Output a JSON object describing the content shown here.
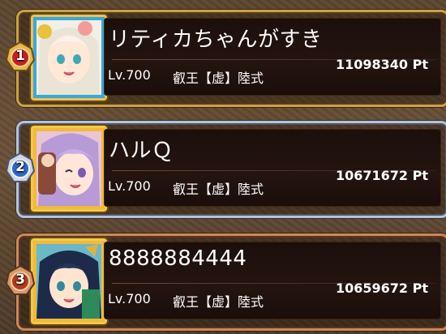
{
  "ranking": [
    {
      "rank": "1",
      "name": "リティカちゃんがすき",
      "level": "Lv.700",
      "title": "叡王【虚】陸式",
      "points": "11098340 Pt",
      "badge_color": "#c8202a",
      "avatar_icon": "elf-girl-avatar"
    },
    {
      "rank": "2",
      "name": "ハルＱ",
      "level": "Lv.700",
      "title": "叡王【虚】陸式",
      "points": "10671672 Pt",
      "badge_color": "#2f67c9",
      "avatar_icon": "purple-hair-girl-avatar"
    },
    {
      "rank": "3",
      "name": "8888884444",
      "level": "Lv.700",
      "title": "叡王【虚】陸式",
      "points": "10659672 Pt",
      "badge_color": "#b23a1a",
      "avatar_icon": "dark-hair-girl-avatar"
    }
  ]
}
